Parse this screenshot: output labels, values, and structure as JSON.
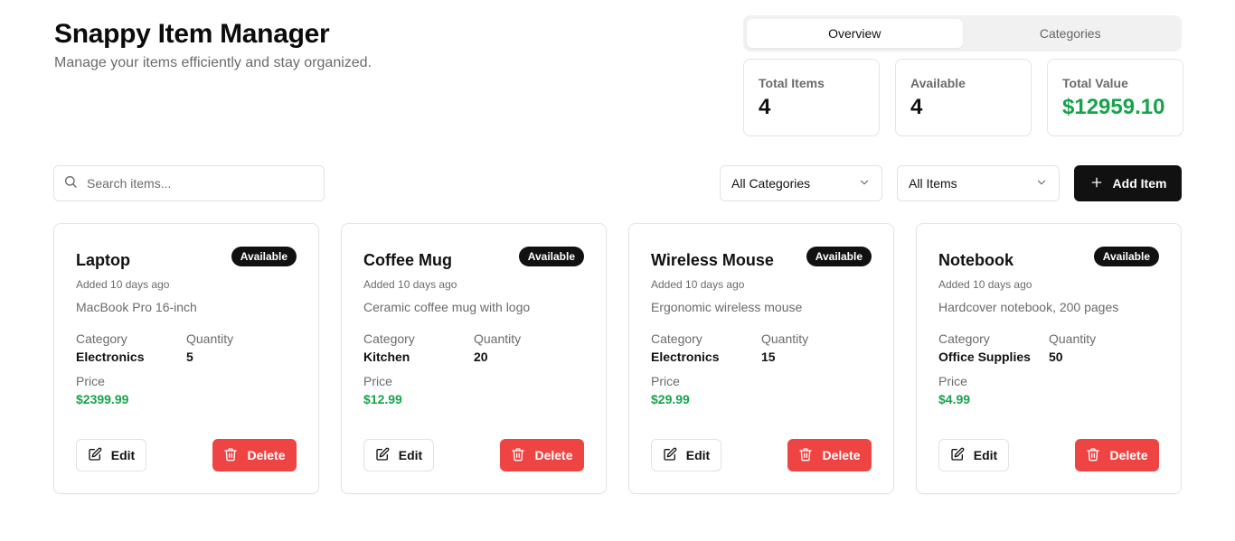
{
  "app": {
    "title": "Snappy Item Manager",
    "subtitle": "Manage your items efficiently and stay organized."
  },
  "tabs": [
    {
      "label": "Overview",
      "active": true
    },
    {
      "label": "Categories",
      "active": false
    }
  ],
  "stats": [
    {
      "label": "Total Items",
      "value": "4"
    },
    {
      "label": "Available",
      "value": "4"
    },
    {
      "label": "Total Value",
      "value": "$12959.10"
    }
  ],
  "toolbar": {
    "search_placeholder": "Search items...",
    "category_filter": "All Categories",
    "status_filter": "All Items",
    "add_label": "Add Item"
  },
  "labels": {
    "category": "Category",
    "quantity": "Quantity",
    "price": "Price",
    "edit": "Edit",
    "delete": "Delete"
  },
  "items": [
    {
      "name": "Laptop",
      "badge": "Available",
      "added": "Added 10 days ago",
      "description": "MacBook Pro 16-inch",
      "category": "Electronics",
      "quantity": "5",
      "price": "$2399.99"
    },
    {
      "name": "Coffee Mug",
      "badge": "Available",
      "added": "Added 10 days ago",
      "description": "Ceramic coffee mug with logo",
      "category": "Kitchen",
      "quantity": "20",
      "price": "$12.99"
    },
    {
      "name": "Wireless Mouse",
      "badge": "Available",
      "added": "Added 10 days ago",
      "description": "Ergonomic wireless mouse",
      "category": "Electronics",
      "quantity": "15",
      "price": "$29.99"
    },
    {
      "name": "Notebook",
      "badge": "Available",
      "added": "Added 10 days ago",
      "description": "Hardcover notebook, 200 pages",
      "category": "Office Supplies",
      "quantity": "50",
      "price": "$4.99"
    }
  ],
  "colors": {
    "accent_green": "#16a34a",
    "danger_red": "#ef4444",
    "primary_dark": "#111111"
  },
  "icons": {
    "search": "search-icon",
    "chevron": "chevron-down-icon",
    "add": "plus-icon",
    "edit": "edit-icon",
    "delete": "trash-icon"
  }
}
